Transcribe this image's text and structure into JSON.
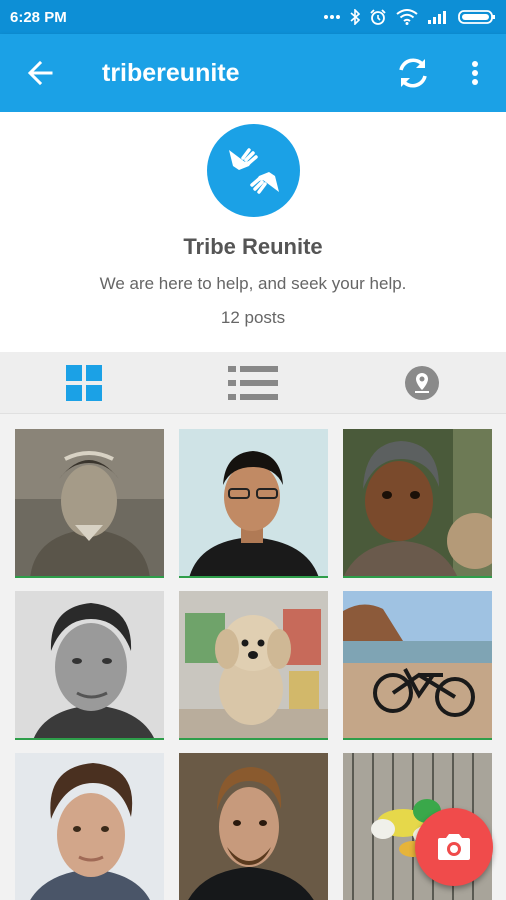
{
  "status_bar": {
    "time": "6:28 PM"
  },
  "app_bar": {
    "title": "tribereunite"
  },
  "profile": {
    "name": "Tribe Reunite",
    "bio": "We are here to help, and seek your help.",
    "posts": "12 posts"
  },
  "tabs": {
    "active": "grid-view"
  },
  "colors": {
    "primary": "#1ba1e6",
    "status": "#0d8fd6",
    "fab": "#f04b4b"
  },
  "posts": [
    {
      "subject": "man-sepia-portrait"
    },
    {
      "subject": "man-with-glasses"
    },
    {
      "subject": "child-portrait"
    },
    {
      "subject": "man-bw-portrait"
    },
    {
      "subject": "puppy"
    },
    {
      "subject": "bicycle-on-beach"
    },
    {
      "subject": "young-man-portrait"
    },
    {
      "subject": "bearded-man-portrait"
    },
    {
      "subject": "parrots-in-cage"
    }
  ]
}
